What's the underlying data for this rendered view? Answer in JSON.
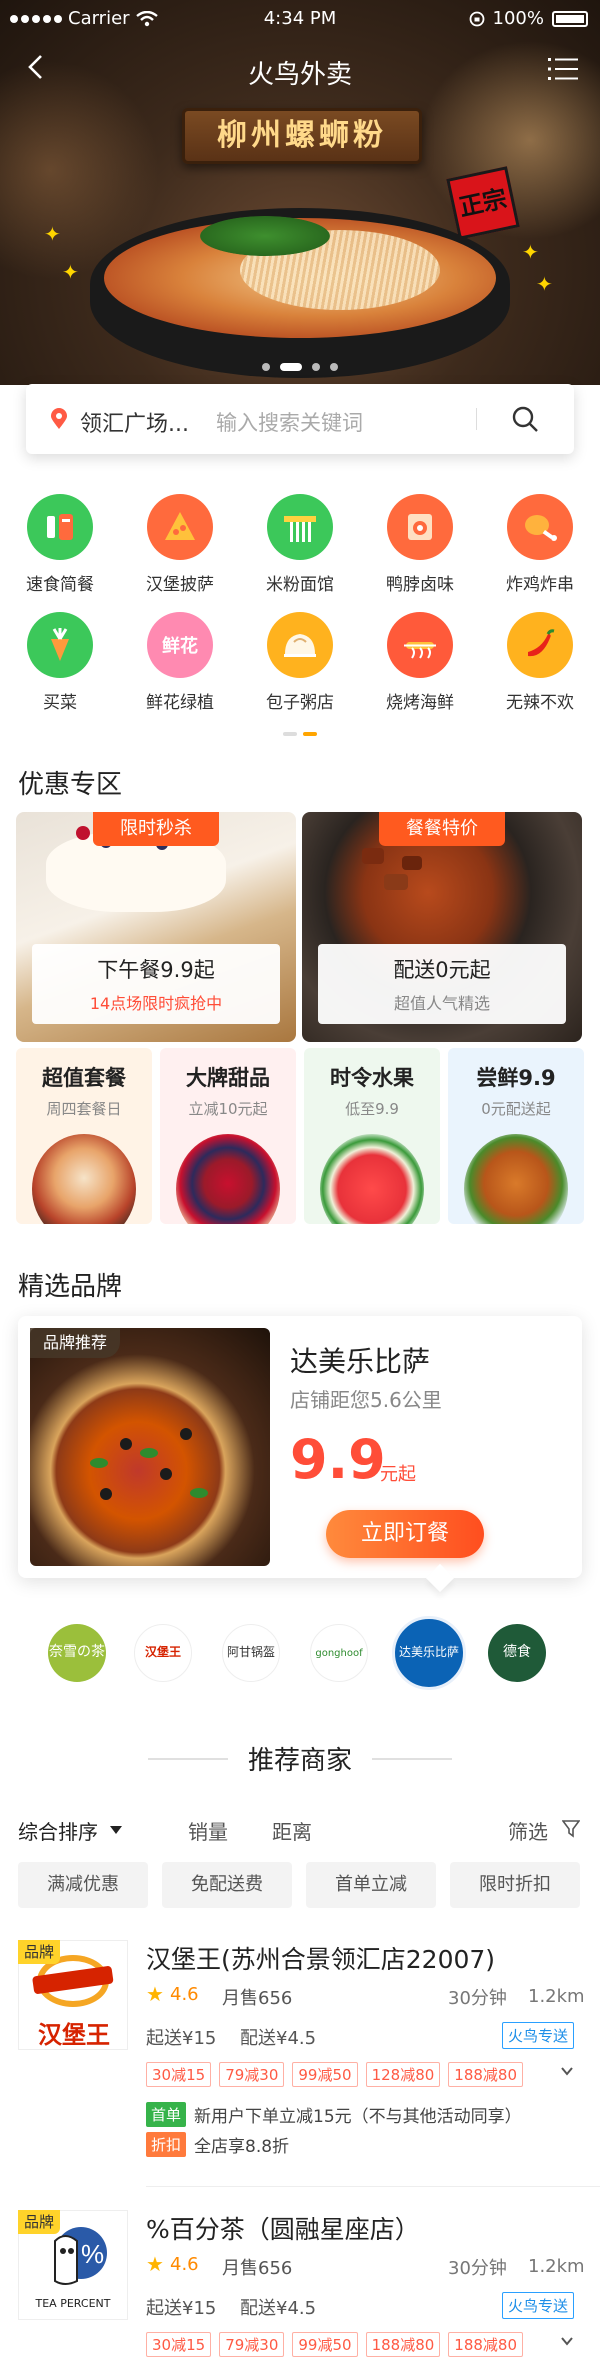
{
  "status_bar": {
    "carrier": "Carrier",
    "time": "4:34 PM",
    "battery": "100%"
  },
  "nav": {
    "title": "火鸟外卖"
  },
  "banner": {
    "sign_text": "柳州螺蛳粉",
    "stamp_text": "正宗",
    "slides": 4,
    "active_slide": 1
  },
  "search": {
    "location": "领汇广场...",
    "placeholder": "输入搜索关键词"
  },
  "categories": [
    {
      "label": "速食简餐",
      "icon": "fast-food-icon",
      "color": "#3cc85a"
    },
    {
      "label": "汉堡披萨",
      "icon": "burger-pizza-icon",
      "color": "#ff6a3d"
    },
    {
      "label": "米粉面馆",
      "icon": "noodle-icon",
      "color": "#3cc85a"
    },
    {
      "label": "鸭脖卤味",
      "icon": "braised-food-icon",
      "color": "#ff6a3d"
    },
    {
      "label": "炸鸡炸串",
      "icon": "fried-chicken-icon",
      "color": "#ff6a3d"
    },
    {
      "label": "买菜",
      "icon": "vegetable-icon",
      "color": "#3cc85a"
    },
    {
      "label": "鲜花绿植",
      "icon": "flower-icon",
      "color": "#ff8ab1",
      "text": "鲜花"
    },
    {
      "label": "包子粥店",
      "icon": "bun-icon",
      "color": "#ffb21e"
    },
    {
      "label": "烧烤海鲜",
      "icon": "bbq-icon",
      "color": "#ff5a3a"
    },
    {
      "label": "无辣不欢",
      "icon": "chili-icon",
      "color": "#ffb21e"
    }
  ],
  "promo": {
    "title": "优惠专区",
    "deals": [
      {
        "tag": "限时秒杀",
        "headline": "下午餐9.9起",
        "sub": "14点场限时疯抢中",
        "sub_color": "#ff4d38"
      },
      {
        "tag": "餐餐特价",
        "headline": "配送0元起",
        "sub": "超值人气精选",
        "sub_color": "#888888"
      }
    ],
    "minis": [
      {
        "headline": "超值套餐",
        "sub": "周四套餐日",
        "bg": "#fff3e6"
      },
      {
        "headline": "大牌甜品",
        "sub": "立减10元起",
        "bg": "#fff0f0"
      },
      {
        "headline": "时令水果",
        "sub": "低至9.9",
        "bg": "#eef8ee"
      },
      {
        "headline": "尝鲜9.9",
        "sub": "0元配送起",
        "bg": "#eaf4fd"
      }
    ]
  },
  "brands": {
    "title": "精选品牌",
    "featured": {
      "badge": "品牌推荐",
      "name": "达美乐比萨",
      "distance": "店铺距您5.6公里",
      "price": "9.9",
      "price_unit": "元起",
      "button": "立即订餐"
    },
    "logos": [
      {
        "name": "奈雪の茶",
        "bg": "#9bbf3b",
        "fg": "#ffffff"
      },
      {
        "name": "汉堡王",
        "bg": "#ffffff",
        "fg": "#d62300"
      },
      {
        "name": "阿甘锅盔",
        "bg": "#ffffff",
        "fg": "#333333"
      },
      {
        "name": "gonghoof",
        "bg": "#ffffff",
        "fg": "#2e8b2e"
      },
      {
        "name": "达美乐比萨",
        "bg": "#0b63b5",
        "fg": "#ffffff",
        "active": true
      },
      {
        "name": "德食",
        "bg": "#1f5a38",
        "fg": "#ffffff"
      }
    ]
  },
  "recommend": {
    "title": "推荐商家",
    "sort": {
      "primary": "综合排序",
      "sales": "销量",
      "distance": "距离",
      "filter": "筛选"
    },
    "chips": [
      "满减优惠",
      "免配送费",
      "首单立减",
      "限时折扣"
    ],
    "shops": [
      {
        "tag": "品牌",
        "logo": "burger-king",
        "name": "汉堡王(苏州合景领汇店22007)",
        "rating": "4.6",
        "sales": "月售656",
        "eta": "30分钟",
        "distance": "1.2km",
        "min_order": "起送¥15",
        "delivery_fee": "配送¥4.5",
        "delivery_label": "火鸟专送",
        "discounts": [
          "30减15",
          "79减30",
          "99减50",
          "128减80",
          "188减80"
        ],
        "promos": [
          {
            "badge": "首单",
            "badge_color": "#36b34a",
            "text": "新用户下单立减15元（不与其他活动同享）"
          },
          {
            "badge": "折扣",
            "badge_color": "#ff7a3c",
            "text": "全店享8.8折"
          }
        ]
      },
      {
        "tag": "品牌",
        "logo": "tea-percent",
        "logo_text": "TEA PERCENT",
        "name": "%百分茶（圆融星座店）",
        "rating": "4.6",
        "sales": "月售656",
        "eta": "30分钟",
        "distance": "1.2km",
        "min_order": "起送¥15",
        "delivery_fee": "配送¥4.5",
        "delivery_label": "火鸟专送",
        "discounts": [
          "30减15",
          "79减30",
          "99减50",
          "188减80",
          "188减80"
        ],
        "promos": []
      }
    ]
  }
}
